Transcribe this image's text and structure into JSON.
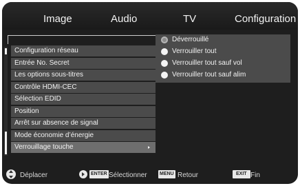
{
  "tabs": [
    "Image",
    "Audio",
    "TV",
    "Configuration"
  ],
  "menu": {
    "items": [
      {
        "label": "Configuration réseau",
        "selected": false
      },
      {
        "label": "Entrée No. Secret",
        "selected": false
      },
      {
        "label": "Les options sous-titres",
        "selected": false
      },
      {
        "label": "Contrôle HDMI-CEC",
        "selected": false
      },
      {
        "label": "Sélection EDID",
        "selected": false
      },
      {
        "label": "Position",
        "selected": false
      },
      {
        "label": "Arrêt sur absence de signal",
        "selected": false
      },
      {
        "label": "Mode économie d’énergie",
        "selected": false
      },
      {
        "label": "Verrouillage touche",
        "selected": true
      }
    ]
  },
  "options": {
    "items": [
      {
        "label": "Déverrouillé",
        "checked": true
      },
      {
        "label": "Verrouiller tout",
        "checked": false
      },
      {
        "label": "Verrouiller tout sauf vol",
        "checked": false
      },
      {
        "label": "Verrouiller tout sauf alim",
        "checked": false
      }
    ]
  },
  "help": {
    "move_label": "Déplacer",
    "enter_key": "ENTER",
    "select_label": "Sélectionner",
    "menu_key": "MENU",
    "back_label": "Retour",
    "exit_key": "EXIT",
    "exit_label": "Fin"
  },
  "colors": {
    "background": "#1e1e1e",
    "menu_item": "#4b4b4b",
    "menu_item_selected": "#6e6e6e",
    "text": "#f2f2f2"
  }
}
